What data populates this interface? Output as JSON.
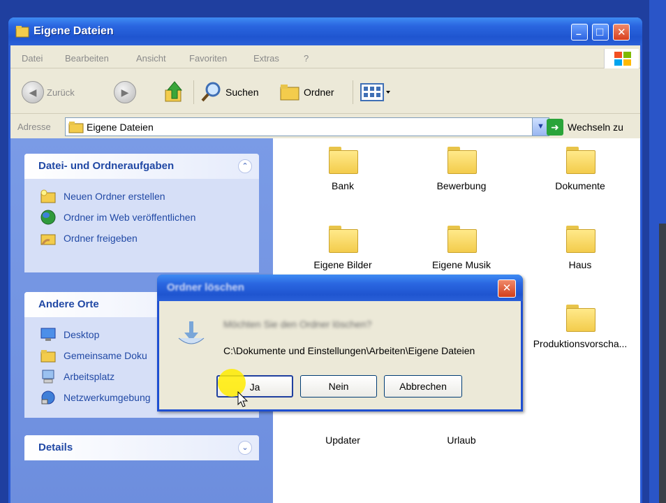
{
  "window": {
    "title": "Eigene Dateien",
    "minimize_glyph": "–",
    "maximize_glyph": "□",
    "close_glyph": "✕"
  },
  "menu": [
    "Datei",
    "Bearbeiten",
    "Ansicht",
    "Favoriten",
    "Extras",
    "?"
  ],
  "toolbar": {
    "back_label": "Zurück",
    "search_label": "Suchen",
    "folders_label": "Ordner"
  },
  "address": {
    "label": "Adresse",
    "value": "Eigene Dateien",
    "go_label": "Wechseln zu"
  },
  "tasks": {
    "title": "Datei- und Ordneraufgaben",
    "items": [
      "Neuen Ordner erstellen",
      "Ordner im Web veröffentlichen",
      "Ordner freigeben"
    ]
  },
  "places": {
    "title": "Andere Orte",
    "items": [
      "Desktop",
      "Gemeinsame Doku",
      "Arbeitsplatz",
      "Netzwerkumgebung"
    ]
  },
  "details": {
    "title": "Details"
  },
  "folders": [
    "Bank",
    "Bewerbung",
    "Dokumente",
    "Eigene Bilder",
    "Eigene Musik",
    "Haus",
    "Produktionsvorscha...",
    "Updater",
    "Urlaub"
  ],
  "dialog": {
    "title": "Ordner löschen",
    "message": "Möchten Sie den Ordner löschen?",
    "path": "C:\\Dokumente und Einstellungen\\Arbeiten\\Eigene Dateien",
    "buttons": {
      "yes": "Ja",
      "no": "Nein",
      "cancel": "Abbrechen"
    },
    "close_glyph": "✕"
  },
  "colors": {
    "xp_title_blue": "#2a66e0",
    "taskpane_blue": "#7a9be6",
    "link_blue": "#2149a5",
    "cursor_highlight": "#ffeb00"
  }
}
